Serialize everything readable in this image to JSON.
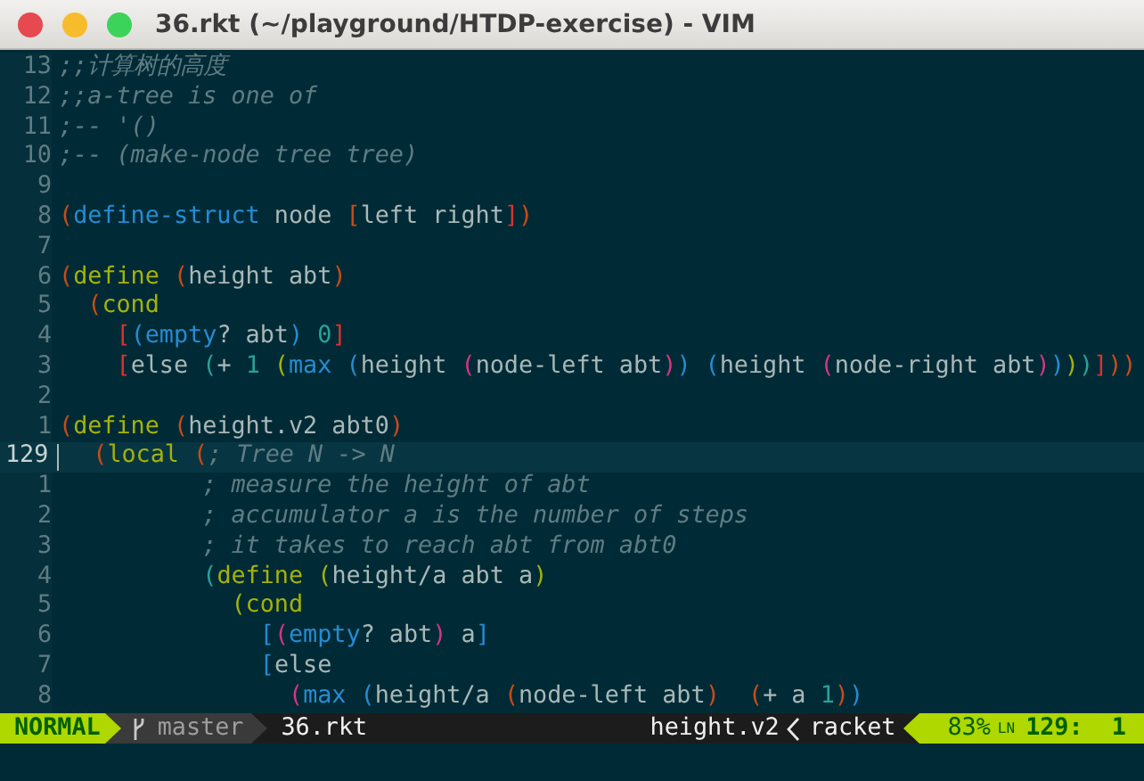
{
  "window": {
    "title": "36.rkt (~/playground/HTDP-exercise) - VIM"
  },
  "editor": {
    "lines": [
      {
        "number": "13",
        "current": false,
        "segments": [
          {
            "kind": "comment",
            "text": ";;计算树的高度"
          }
        ]
      },
      {
        "number": "12",
        "current": false,
        "segments": [
          {
            "kind": "comment",
            "text": ";;a-tree is one of"
          }
        ]
      },
      {
        "number": "11",
        "current": false,
        "segments": [
          {
            "kind": "comment",
            "text": ";-- '()"
          }
        ]
      },
      {
        "number": "10",
        "current": false,
        "segments": [
          {
            "kind": "comment",
            "text": ";-- (make-node tree tree)"
          }
        ]
      },
      {
        "number": "9",
        "current": false
      },
      {
        "number": "8",
        "current": false,
        "segments": [
          {
            "kind": "code",
            "color": "#cb4b16",
            "text": "("
          },
          {
            "kind": "code",
            "color": "#268bd2",
            "text": "define-struct"
          },
          {
            "kind": "code",
            "color": "#a9b7b7",
            "text": " node "
          },
          {
            "kind": "code",
            "color": "#cb4b16",
            "text": "["
          },
          {
            "kind": "code",
            "color": "#a9b7b7",
            "text": "left right"
          },
          {
            "kind": "code",
            "color": "#dc322f",
            "text": "]"
          },
          {
            "kind": "code",
            "color": "#cb4b16",
            "text": ")"
          }
        ]
      },
      {
        "number": "7",
        "current": false
      },
      {
        "number": "6",
        "current": false,
        "segments": [
          {
            "kind": "code",
            "color": "#cb4b16",
            "text": "("
          },
          {
            "kind": "code",
            "color": "#a4b20a",
            "text": "define"
          },
          {
            "kind": "code",
            "color": "#cb4b16",
            "text": " ("
          },
          {
            "kind": "code",
            "color": "#a9b7b7",
            "text": "height abt"
          },
          {
            "kind": "code",
            "color": "#cb4b16",
            "text": ")"
          }
        ]
      },
      {
        "number": "5",
        "current": false,
        "segments": [
          {
            "kind": "code",
            "color": "#cb4b16",
            "text": "  ("
          },
          {
            "kind": "code",
            "color": "#a4b20a",
            "text": "cond"
          }
        ]
      },
      {
        "number": "4",
        "current": false,
        "segments": [
          {
            "kind": "code",
            "color": "#dc322f",
            "text": "    ["
          },
          {
            "kind": "code",
            "color": "#268bd2",
            "text": "(empty"
          },
          {
            "kind": "code",
            "color": "#a9b7b7",
            "text": "? abt"
          },
          {
            "kind": "code",
            "color": "#268bd2",
            "text": ")"
          },
          {
            "kind": "code",
            "color": "#2aa198",
            "text": " 0"
          },
          {
            "kind": "code",
            "color": "#dc322f",
            "text": "]"
          }
        ]
      },
      {
        "number": "3",
        "current": false,
        "segments": [
          {
            "kind": "code",
            "color": "#dc322f",
            "text": "    ["
          },
          {
            "kind": "code",
            "color": "#a9b7b7",
            "text": "else "
          },
          {
            "kind": "code",
            "color": "#2aa198",
            "text": "("
          },
          {
            "kind": "code",
            "color": "#a9b7b7",
            "text": "+ "
          },
          {
            "kind": "code",
            "color": "#2aa198",
            "text": "1"
          },
          {
            "kind": "code",
            "color": "#a4b20a",
            "text": " ("
          },
          {
            "kind": "code",
            "color": "#268bd2",
            "text": "max"
          },
          {
            "kind": "code",
            "color": "#268bd2",
            "text": " ("
          },
          {
            "kind": "code",
            "color": "#a9b7b7",
            "text": "height"
          },
          {
            "kind": "code",
            "color": "#d33682",
            "text": " ("
          },
          {
            "kind": "code",
            "color": "#a9b7b7",
            "text": "node-left abt"
          },
          {
            "kind": "code",
            "color": "#d33682",
            "text": ")"
          },
          {
            "kind": "code",
            "color": "#268bd2",
            "text": ")"
          },
          {
            "kind": "code",
            "color": "#268bd2",
            "text": " ("
          },
          {
            "kind": "code",
            "color": "#a9b7b7",
            "text": "height"
          },
          {
            "kind": "code",
            "color": "#d33682",
            "text": " ("
          },
          {
            "kind": "code",
            "color": "#a9b7b7",
            "text": "node-right abt"
          },
          {
            "kind": "code",
            "color": "#d33682",
            "text": ")"
          },
          {
            "kind": "code",
            "color": "#268bd2",
            "text": ")"
          },
          {
            "kind": "code",
            "color": "#a4b20a",
            "text": ")"
          },
          {
            "kind": "code",
            "color": "#2aa198",
            "text": ")"
          },
          {
            "kind": "code",
            "color": "#dc322f",
            "text": "]"
          },
          {
            "kind": "code",
            "color": "#cb4b16",
            "text": "))"
          }
        ]
      },
      {
        "number": "2",
        "current": false
      },
      {
        "number": "1",
        "current": false,
        "segments": [
          {
            "kind": "code",
            "color": "#cb4b16",
            "text": "("
          },
          {
            "kind": "code",
            "color": "#a4b20a",
            "text": "define"
          },
          {
            "kind": "code",
            "color": "#cb4b16",
            "text": " ("
          },
          {
            "kind": "code",
            "color": "#a9b7b7",
            "text": "height.v2 abt0"
          },
          {
            "kind": "code",
            "color": "#cb4b16",
            "text": ")"
          }
        ]
      },
      {
        "number": "129",
        "current": true,
        "segments": [
          {
            "kind": "code",
            "color": "#cb4b16",
            "text": "  ("
          },
          {
            "kind": "code",
            "color": "#a4b20a",
            "text": "local"
          },
          {
            "kind": "code",
            "color": "#cb4b16",
            "text": " ("
          },
          {
            "kind": "comment",
            "text": "; Tree N -> N"
          }
        ]
      },
      {
        "number": "1",
        "current": false,
        "segments": [
          {
            "kind": "comment",
            "text": "          ; measure the height of abt"
          }
        ]
      },
      {
        "number": "2",
        "current": false,
        "segments": [
          {
            "kind": "comment",
            "text": "          ; accumulator a is the number of steps"
          }
        ]
      },
      {
        "number": "3",
        "current": false,
        "segments": [
          {
            "kind": "comment",
            "text": "          ; it takes to reach abt from abt0"
          }
        ]
      },
      {
        "number": "4",
        "current": false,
        "segments": [
          {
            "kind": "code",
            "color": "#2aa198",
            "text": "          ("
          },
          {
            "kind": "code",
            "color": "#a4b20a",
            "text": "define ("
          },
          {
            "kind": "code",
            "color": "#a9b7b7",
            "text": "height/a abt a"
          },
          {
            "kind": "code",
            "color": "#a4b20a",
            "text": ")"
          }
        ]
      },
      {
        "number": "5",
        "current": false,
        "segments": [
          {
            "kind": "code",
            "color": "#a4b20a",
            "text": "            (cond"
          }
        ]
      },
      {
        "number": "6",
        "current": false,
        "segments": [
          {
            "kind": "code",
            "color": "#268bd2",
            "text": "              ["
          },
          {
            "kind": "code",
            "color": "#d33682",
            "text": "("
          },
          {
            "kind": "code",
            "color": "#268bd2",
            "text": "empty"
          },
          {
            "kind": "code",
            "color": "#a9b7b7",
            "text": "? abt"
          },
          {
            "kind": "code",
            "color": "#d33682",
            "text": ")"
          },
          {
            "kind": "code",
            "color": "#a9b7b7",
            "text": " a"
          },
          {
            "kind": "code",
            "color": "#268bd2",
            "text": "]"
          }
        ]
      },
      {
        "number": "7",
        "current": false,
        "segments": [
          {
            "kind": "code",
            "color": "#268bd2",
            "text": "              ["
          },
          {
            "kind": "code",
            "color": "#a9b7b7",
            "text": "else"
          }
        ]
      },
      {
        "number": "8",
        "current": false,
        "segments": [
          {
            "kind": "code",
            "color": "#d33682",
            "text": "                ("
          },
          {
            "kind": "code",
            "color": "#268bd2",
            "text": "max ("
          },
          {
            "kind": "code",
            "color": "#a9b7b7",
            "text": "height/a "
          },
          {
            "kind": "code",
            "color": "#cb4b16",
            "text": "("
          },
          {
            "kind": "code",
            "color": "#a9b7b7",
            "text": "node-left abt"
          },
          {
            "kind": "code",
            "color": "#cb4b16",
            "text": ")"
          },
          {
            "kind": "code",
            "color": "#cb4b16",
            "text": "  ("
          },
          {
            "kind": "code",
            "color": "#a9b7b7",
            "text": "+ a "
          },
          {
            "kind": "code",
            "color": "#2aa198",
            "text": "1"
          },
          {
            "kind": "code",
            "color": "#cb4b16",
            "text": ")"
          },
          {
            "kind": "code",
            "color": "#268bd2",
            "text": ")"
          }
        ]
      }
    ]
  },
  "status_bar": {
    "mode": "NORMAL",
    "branch": "master",
    "file": "36.rkt",
    "function": "height.v2",
    "filetype": "racket",
    "percent": "83%",
    "line_symbol": "LN",
    "position": "129:  1"
  }
}
